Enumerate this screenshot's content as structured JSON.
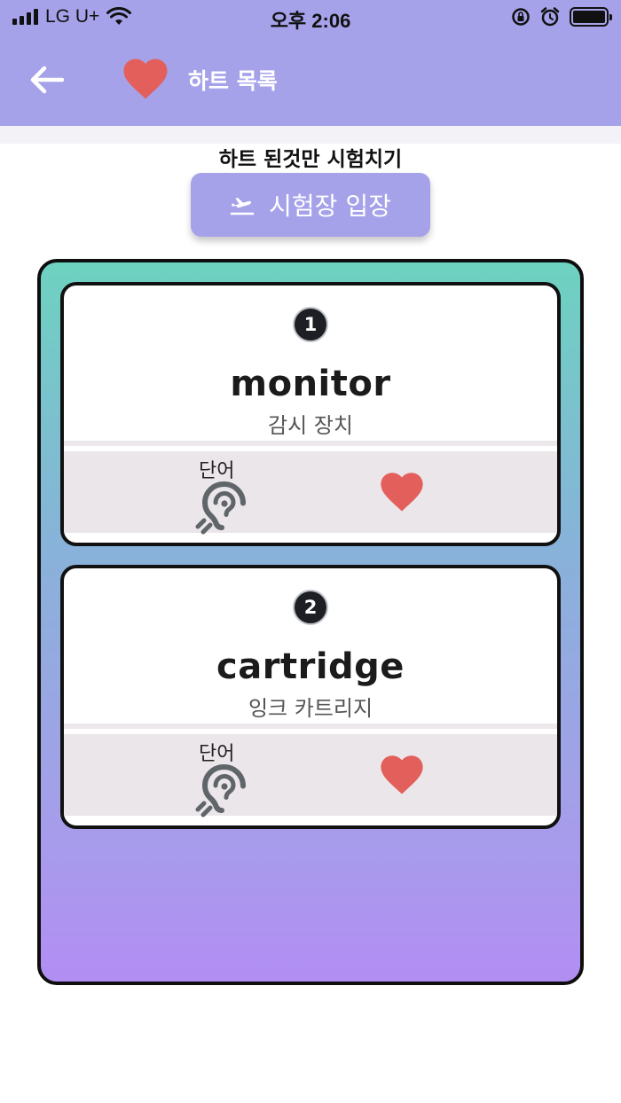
{
  "status_bar": {
    "carrier": "LG U+",
    "time": "오후 2:06"
  },
  "app_bar": {
    "title": "하트 목록"
  },
  "quiz": {
    "label": "하트 된것만 시험치기",
    "button_label": "시험장 입장"
  },
  "cards": [
    {
      "number": "1",
      "word": "monitor",
      "meaning": "감시 장치",
      "listen_label": "단어",
      "hearted": true
    },
    {
      "number": "2",
      "word": "cartridge",
      "meaning": "잉크 카트리지",
      "listen_label": "단어",
      "hearted": true
    }
  ],
  "icons": {
    "back": "back-arrow-icon",
    "title": "heart-icon",
    "enter": "flight-takeoff-icon",
    "listen": "hearing-icon",
    "favorite": "heart-icon"
  },
  "colors": {
    "primary": "#a6a2ea",
    "heart": "#e35f5b",
    "ear": "#5f6569",
    "panel_top": "#6dd2c0",
    "panel_bottom": "#b28ef3"
  }
}
